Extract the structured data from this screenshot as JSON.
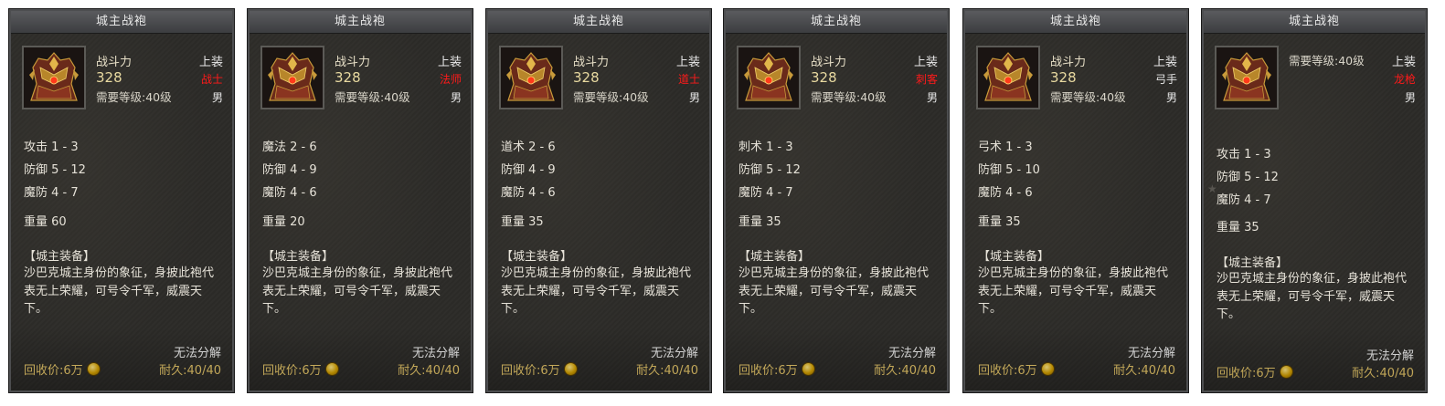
{
  "panels": [
    {
      "title": "城主战袍",
      "combat_label": "战斗力",
      "combat_value": "328",
      "req_level": "需要等级:40级",
      "slot": "上装",
      "class": "战士",
      "gender": "男",
      "stats": [
        "攻击 1 - 3",
        "防御 5 - 12",
        "魔防 4 - 7"
      ],
      "weight": "重量 60",
      "desc_title": "【城主装备】",
      "desc_text": "沙巴克城主身份的象征，身披此袍代表无上荣耀，可号令千军，威震天下。",
      "no_dismantle": "无法分解",
      "price": "回收价:6万",
      "durability": "耐久:40/40"
    },
    {
      "title": "城主战袍",
      "combat_label": "战斗力",
      "combat_value": "328",
      "req_level": "需要等级:40级",
      "slot": "上装",
      "class": "法师",
      "gender": "男",
      "stats": [
        "魔法 2 - 6",
        "防御 4 - 9",
        "魔防 4 - 6"
      ],
      "weight": "重量 20",
      "desc_title": "【城主装备】",
      "desc_text": "沙巴克城主身份的象征，身披此袍代表无上荣耀，可号令千军，威震天下。",
      "no_dismantle": "无法分解",
      "price": "回收价:6万",
      "durability": "耐久:40/40"
    },
    {
      "title": "城主战袍",
      "combat_label": "战斗力",
      "combat_value": "328",
      "req_level": "需要等级:40级",
      "slot": "上装",
      "class": "道士",
      "gender": "男",
      "stats": [
        "道术 2 - 6",
        "防御 4 - 9",
        "魔防 4 - 6"
      ],
      "weight": "重量 35",
      "desc_title": "【城主装备】",
      "desc_text": "沙巴克城主身份的象征，身披此袍代表无上荣耀，可号令千军，威震天下。",
      "no_dismantle": "无法分解",
      "price": "回收价:6万",
      "durability": "耐久:40/40"
    },
    {
      "title": "城主战袍",
      "combat_label": "战斗力",
      "combat_value": "328",
      "req_level": "需要等级:40级",
      "slot": "上装",
      "class": "刺客",
      "gender": "男",
      "stats": [
        "刺术 1 - 3",
        "防御 5 - 12",
        "魔防 4 - 7"
      ],
      "weight": "重量 35",
      "desc_title": "【城主装备】",
      "desc_text": "沙巴克城主身份的象征，身披此袍代表无上荣耀，可号令千军，威震天下。",
      "no_dismantle": "无法分解",
      "price": "回收价:6万",
      "durability": "耐久:40/40"
    },
    {
      "title": "城主战袍",
      "combat_label": "战斗力",
      "combat_value": "328",
      "req_level": "需要等级:40级",
      "slot": "上装",
      "class": "弓手",
      "gender": "男",
      "stats": [
        "弓术 1 - 3",
        "防御 5 - 10",
        "魔防 4 - 6"
      ],
      "weight": "重量 35",
      "desc_title": "【城主装备】",
      "desc_text": "沙巴克城主身份的象征，身披此袍代表无上荣耀，可号令千军，威震天下。",
      "no_dismantle": "无法分解",
      "price": "回收价:6万",
      "durability": "耐久:40/40"
    },
    {
      "title": "城主战袍",
      "combat_label": "",
      "combat_value": "",
      "req_level": "需要等级:40级",
      "slot": "上装",
      "class": "龙枪",
      "gender": "男",
      "stats": [
        "攻击 1 - 3",
        "防御 5 - 12",
        "魔防 4 - 7"
      ],
      "weight": "重量 35",
      "desc_title": "【城主装备】",
      "desc_text": "沙巴克城主身份的象征，身披此袍代表无上荣耀，可号令千军，威震天下。",
      "no_dismantle": "无法分解",
      "price": "回收价:6万",
      "durability": "耐久:40/40"
    }
  ],
  "class_colors": {
    "战士": "#ff1a1a",
    "法师": "#ff1a1a",
    "道士": "#ff1a1a",
    "刺客": "#ff1a1a",
    "弓手": "#e6e6e6",
    "龙枪": "#ff1a1a"
  },
  "icons": {
    "item": "robe-armor-icon",
    "coin": "gold-coin-icon"
  }
}
